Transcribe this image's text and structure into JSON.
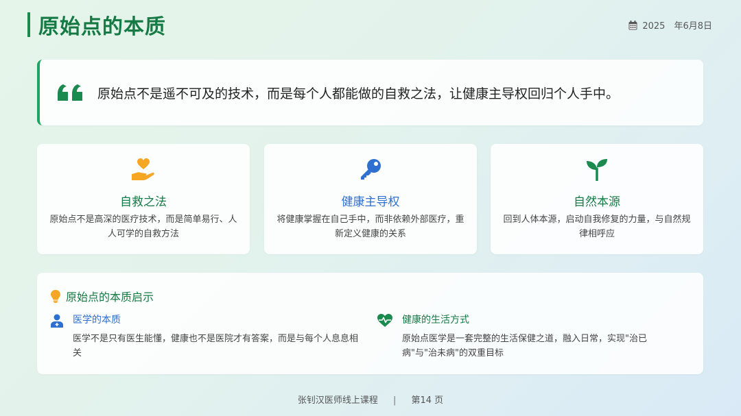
{
  "title": "原始点的本质",
  "date": "2025　年6月8日",
  "quote": "原始点不是遥不可及的技术，而是每个人都能做的自救之法，让健康主导权回归个人手中。",
  "features": [
    {
      "icon": "hand-heart-icon",
      "title": "自救之法",
      "desc": "原始点不是高深的医疗技术，而是简单易行、人人可学的自救方法",
      "color": "#f5a623"
    },
    {
      "icon": "key-icon",
      "title": "健康主导权",
      "desc": "将健康掌握在自己手中，而非依赖外部医疗，重新定义健康的关系",
      "color": "#2e6fcf"
    },
    {
      "icon": "sprout-icon",
      "title": "自然本源",
      "desc": "回到人体本源，启动自我修复的力量，与自然规律相呼应",
      "color": "#1a8a4f"
    }
  ],
  "insight": {
    "title": "原始点的本质启示",
    "items": [
      {
        "icon": "doctor-icon",
        "title": "医学的本质",
        "desc": "医学不是只有医生能懂，健康也不是医院才有答案，而是与每个人息息相关"
      },
      {
        "icon": "heartbeat-icon",
        "title": "健康的生活方式",
        "desc": "原始点医学是一套完整的生活保健之道，融入日常，实现\"治已病\"与\"治未病\"的双重目标"
      }
    ]
  },
  "footer": {
    "course": "张钊汉医师线上课程",
    "separator": "|",
    "page": "第14 页"
  },
  "colors": {
    "accent_green": "#157a44",
    "accent_blue": "#2e6fcf",
    "accent_orange": "#f5a623"
  }
}
